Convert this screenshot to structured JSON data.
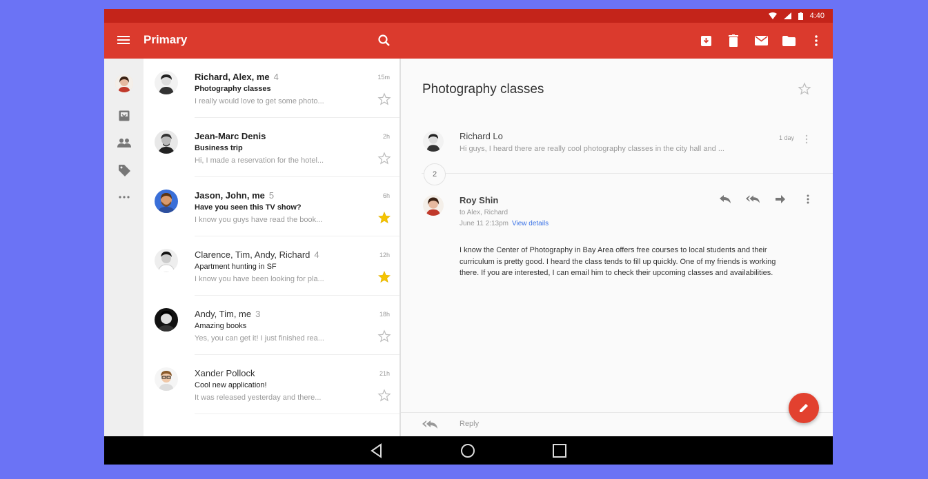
{
  "status_bar": {
    "time": "4:40"
  },
  "app_bar": {
    "title": "Primary"
  },
  "inbox": [
    {
      "sender": "Richard, Alex, me",
      "count": "4",
      "subject": "Photography classes",
      "snippet": "I really would love to get some photo...",
      "time": "15m",
      "starred": false,
      "unread": true
    },
    {
      "sender": "Jean-Marc Denis",
      "count": "",
      "subject": "Business trip",
      "snippet": "Hi, I made a reservation for the hotel...",
      "time": "2h",
      "starred": false,
      "unread": true
    },
    {
      "sender": "Jason, John, me",
      "count": "5",
      "subject": "Have you seen this TV show?",
      "snippet": "I know you guys have read the book...",
      "time": "6h",
      "starred": true,
      "unread": true
    },
    {
      "sender": "Clarence, Tim, Andy, Richard",
      "count": "4",
      "subject": "Apartment hunting in SF",
      "snippet": "I know you have been looking for pla...",
      "time": "12h",
      "starred": true,
      "unread": false
    },
    {
      "sender": "Andy, Tim, me",
      "count": "3",
      "subject": "Amazing books",
      "snippet": "Yes, you can get it! I just finished rea...",
      "time": "18h",
      "starred": false,
      "unread": false
    },
    {
      "sender": "Xander Pollock",
      "count": "",
      "subject": "Cool new application!",
      "snippet": "It was released yesterday and there...",
      "time": "21h",
      "starred": false,
      "unread": false
    }
  ],
  "thread": {
    "subject": "Photography classes",
    "collapsed_count": "2",
    "first_message": {
      "sender": "Richard Lo",
      "snippet": "Hi guys, I heard there are really cool photography classes in the city hall and ...",
      "time": "1 day"
    },
    "open_message": {
      "sender": "Roy Shin",
      "to": "to Alex, Richard",
      "date": "June 11 2:13pm",
      "view_details": "View details",
      "body": "I know the Center of Photography in Bay Area offers free courses to local students and their curriculum is pretty good. I heard the class tends to fill up quickly. One of my friends is working there. If you are interested, I can email him to check their upcoming classes and availabilities."
    },
    "reply_label": "Reply"
  },
  "colors": {
    "app_bar": "#db3a2d",
    "status_bar": "#c4241a",
    "fab": "#e2412f",
    "star_on": "#f5c400",
    "link": "#3b73e6"
  }
}
